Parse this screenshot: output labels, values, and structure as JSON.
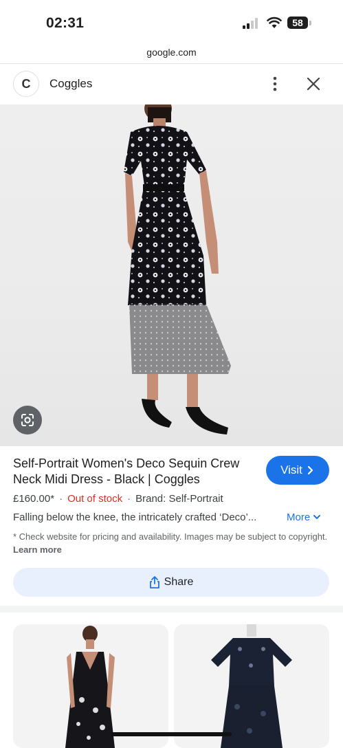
{
  "status_bar": {
    "time": "02:31",
    "battery": "58"
  },
  "browser": {
    "url": "google.com"
  },
  "site": {
    "logo_letter": "C",
    "name": "Coggles"
  },
  "product": {
    "title": "Self-Portrait Women's Deco Sequin Crew Neck Midi Dress - Black | Coggles",
    "visit_label": "Visit",
    "price": "£160.00*",
    "stock": "Out of stock",
    "brand": "Brand: Self-Portrait",
    "description": "Falling below the knee, the intricately crafted ‘Deco’...",
    "more_label": "More",
    "disclaimer": "* Check website for pricing and availability. Images may be subject to copyright.",
    "learn_more": "Learn more",
    "share_label": "Share"
  },
  "colors": {
    "accent": "#1a73e8",
    "out_of_stock": "#d93025",
    "share_bg": "#e8f0fe"
  },
  "icons": [
    "signal-icon",
    "wifi-icon",
    "battery-icon",
    "more-vert-icon",
    "close-icon",
    "lens-icon",
    "chevron-right-icon",
    "chevron-down-icon",
    "share-icon"
  ]
}
